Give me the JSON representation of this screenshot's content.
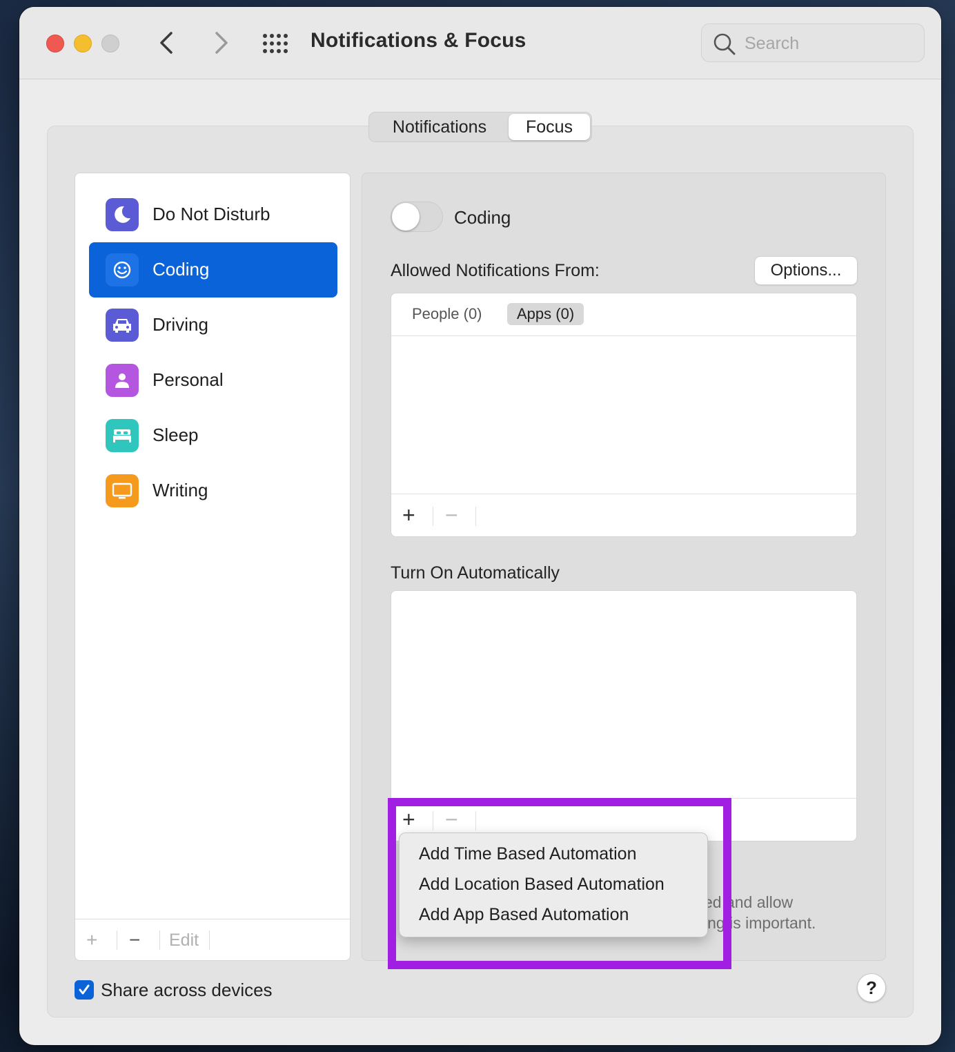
{
  "window": {
    "title": "Notifications & Focus"
  },
  "search": {
    "placeholder": "Search"
  },
  "segmented": {
    "notifications": "Notifications",
    "focus": "Focus",
    "selected": "Focus"
  },
  "sidebar": {
    "items": [
      {
        "label": "Do Not Disturb",
        "icon": "moon-icon",
        "color": "#5b5bd6"
      },
      {
        "label": "Coding",
        "icon": "smiley-icon",
        "color": "#0a63d8",
        "selected": true
      },
      {
        "label": "Driving",
        "icon": "car-icon",
        "color": "#5b5bd6"
      },
      {
        "label": "Personal",
        "icon": "person-icon",
        "color": "#b456e0"
      },
      {
        "label": "Sleep",
        "icon": "bed-icon",
        "color": "#2fc6bd"
      },
      {
        "label": "Writing",
        "icon": "monitor-icon",
        "color": "#f59a1d"
      }
    ],
    "add": "+",
    "remove": "−",
    "edit": "Edit"
  },
  "focus": {
    "name": "Coding",
    "enabled": false,
    "allowed_label": "Allowed Notifications From:",
    "options_button": "Options...",
    "tabs": {
      "people": "People (0)",
      "apps": "Apps (0)"
    },
    "add": "+",
    "remove": "−"
  },
  "automation": {
    "label": "Turn On Automatically",
    "add": "+",
    "remove": "−",
    "menu": [
      "Add Time Based Automation",
      "Add Location Based Automation",
      "Add App Based Automation"
    ],
    "description_line1": "ed and allow",
    "description_line2": "ing is important."
  },
  "footer": {
    "share_label": "Share across devices",
    "share_checked": true,
    "help": "?"
  },
  "colors": {
    "accent": "#0a63d8",
    "highlight": "#a11ee3"
  }
}
